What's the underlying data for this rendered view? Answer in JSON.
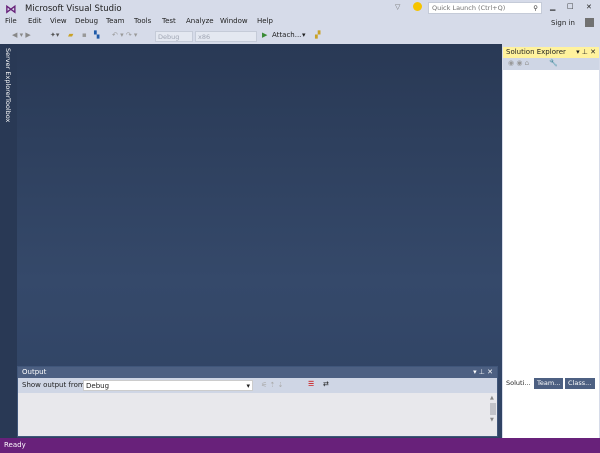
{
  "window": {
    "title": "Microsoft Visual Studio",
    "quick_launch_placeholder": "Quick Launch (Ctrl+Q)",
    "sign_in": "Sign in",
    "minimize": "▁",
    "maximize": "□",
    "close": "✕"
  },
  "menu": [
    "File",
    "Edit",
    "View",
    "Debug",
    "Team",
    "Tools",
    "Test",
    "Analyze",
    "Window",
    "Help"
  ],
  "toolbar": {
    "config": "Debug",
    "platform": "x86",
    "attach": "Attach...",
    "attach_icon": "play-icon"
  },
  "side_tabs": [
    "Server Explorer",
    "Toolbox"
  ],
  "output": {
    "title": "Output",
    "show_from_label": "Show output from:",
    "source": "Debug"
  },
  "solution_explorer": {
    "title": "Solution Explorer",
    "tabs": [
      "Soluti...",
      "Team...",
      "Class..."
    ]
  },
  "status": {
    "text": "Ready"
  },
  "colors": {
    "accent": "#68217a",
    "doc_bg": "#293955",
    "se_header": "#fff29d"
  }
}
